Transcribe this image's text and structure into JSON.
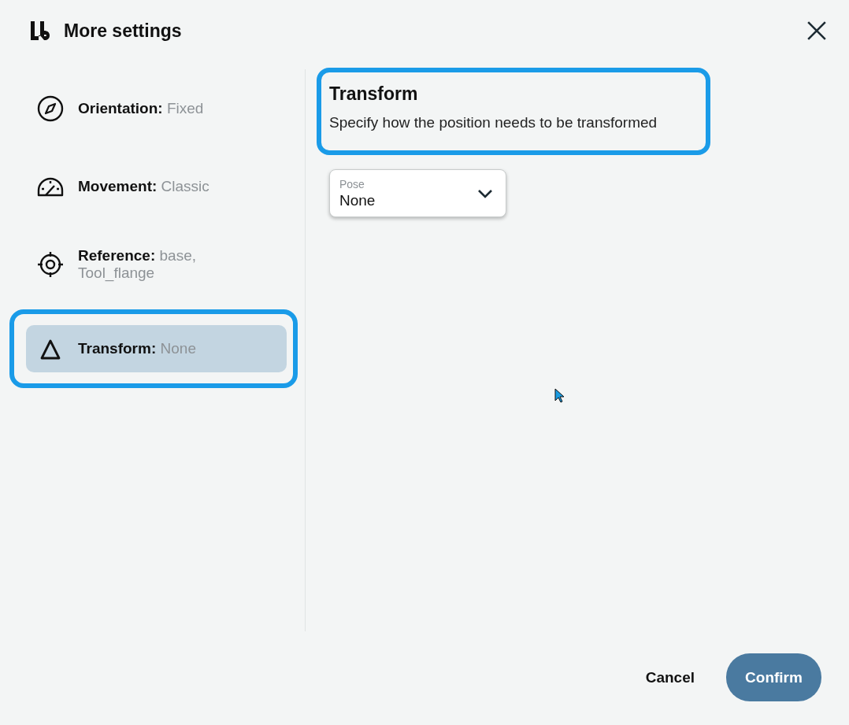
{
  "window": {
    "title": "More settings"
  },
  "sidebar": {
    "items": [
      {
        "kind": "compass",
        "label": "Orientation:",
        "value": "Fixed",
        "selected": false,
        "highlighted": false
      },
      {
        "kind": "gauge",
        "label": "Movement:",
        "value": "Classic",
        "selected": false,
        "highlighted": false
      },
      {
        "kind": "target",
        "label": "Reference:",
        "value": "base, Tool_flange",
        "selected": false,
        "highlighted": false
      },
      {
        "kind": "delta",
        "label": "Transform:",
        "value": "None",
        "selected": true,
        "highlighted": true
      }
    ]
  },
  "section": {
    "title": "Transform",
    "description": "Specify how the position needs to be transformed",
    "highlighted": true
  },
  "pose_dropdown": {
    "label": "Pose",
    "value": "None"
  },
  "buttons": {
    "cancel": "Cancel",
    "confirm": "Confirm"
  }
}
